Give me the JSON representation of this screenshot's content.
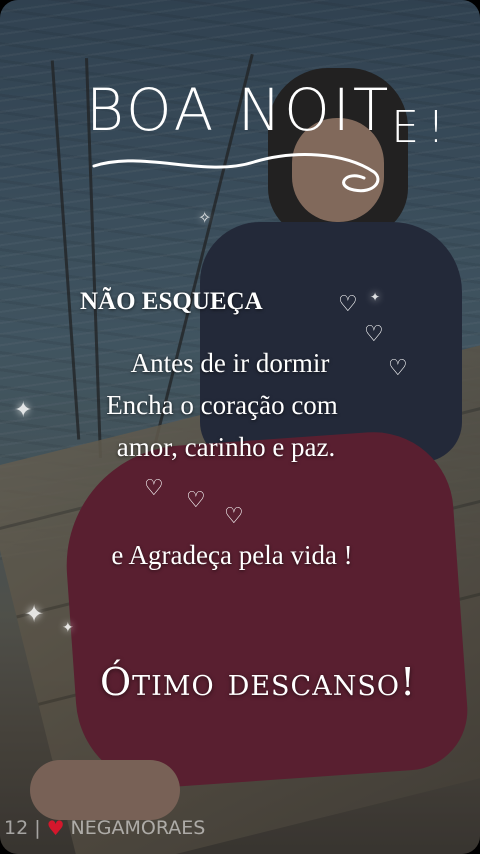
{
  "message": {
    "title_main": "BOA NOIT",
    "title_tail": "E!",
    "subtitle": "NÃO ESQUEÇA",
    "line1": "Antes de ir dormir",
    "line2": "Encha o coração com",
    "line3": "amor, carinho e paz.",
    "line4": "e Agradeça pela vida !",
    "closing": "Ótimo descanso!"
  },
  "footer": {
    "page_number": "12",
    "separator": "|",
    "heart_icon": "heart-icon",
    "username": "NEGAMORAES"
  },
  "colors": {
    "text": "#ffffff",
    "heart_icon": "#d4172c"
  }
}
